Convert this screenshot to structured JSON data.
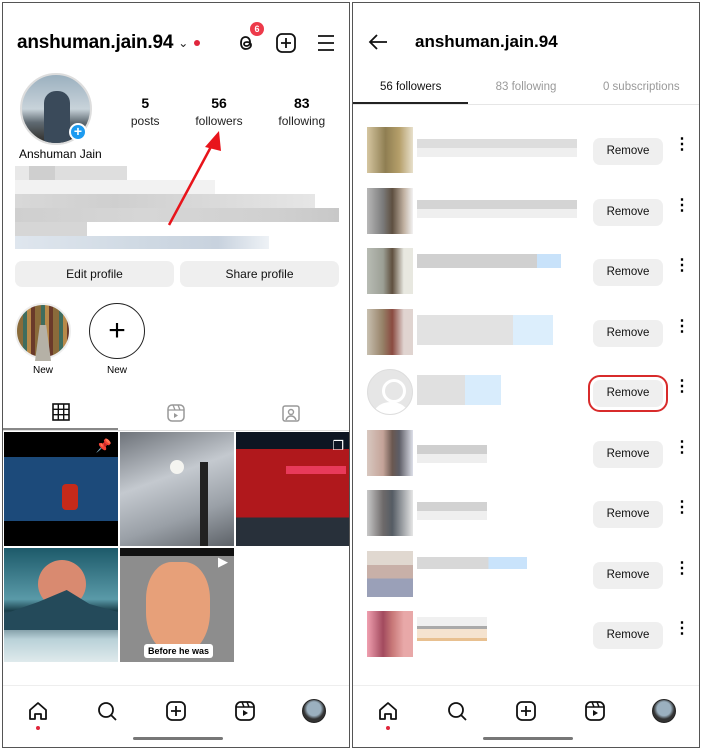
{
  "profile_screen": {
    "username": "anshuman.jain.94",
    "threads_badge_count": "6",
    "display_name": "Anshuman Jain",
    "stats": [
      {
        "value": "5",
        "label": "posts"
      },
      {
        "value": "56",
        "label": "followers"
      },
      {
        "value": "83",
        "label": "following"
      }
    ],
    "buttons": {
      "edit": "Edit profile",
      "share": "Share profile"
    },
    "highlights": [
      {
        "label": "New"
      },
      {
        "label": "New"
      }
    ],
    "grid_caption": "Before he was",
    "annotation": {
      "arrow_color": "#e8141b",
      "points_to": "followers"
    }
  },
  "followers_screen": {
    "title": "anshuman.jain.94",
    "tabs": [
      {
        "label": "56 followers",
        "active": true
      },
      {
        "label": "83 following",
        "active": false
      },
      {
        "label": "0 subscriptions",
        "active": false
      }
    ],
    "remove_label": "Remove",
    "rows": 9,
    "highlighted_row": 5,
    "highlight_color": "#d82b2b"
  },
  "colors": {
    "accent_red": "#e0263c",
    "badge_blue": "#1d9bf0",
    "button_bg": "#efefef"
  }
}
